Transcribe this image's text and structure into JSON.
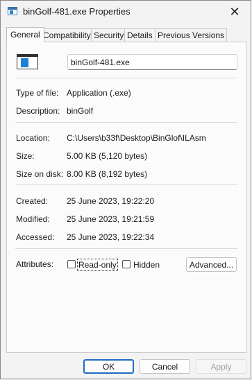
{
  "window": {
    "title": "binGolf-481.exe Properties",
    "close_glyph": "✕"
  },
  "tabs": [
    {
      "label": "General",
      "active": true
    },
    {
      "label": "Compatibility",
      "active": false
    },
    {
      "label": "Security",
      "active": false
    },
    {
      "label": "Details",
      "active": false
    },
    {
      "label": "Previous Versions",
      "active": false
    }
  ],
  "general": {
    "file_icon": "application-icon",
    "filename": "binGolf-481.exe",
    "type_label": "Type of file:",
    "type_value": "Application (.exe)",
    "description_label": "Description:",
    "description_value": "binGolf",
    "location_label": "Location:",
    "location_value": "C:\\Users\\b33f\\Desktop\\BinGlof\\ILAsm",
    "size_label": "Size:",
    "size_value": "5.00 KB (5,120 bytes)",
    "size_on_disk_label": "Size on disk:",
    "size_on_disk_value": "8.00 KB (8,192 bytes)",
    "created_label": "Created:",
    "created_value": "25 June 2023, 19:22:20",
    "modified_label": "Modified:",
    "modified_value": "25 June 2023, 19:21:59",
    "accessed_label": "Accessed:",
    "accessed_value": "25 June 2023, 19:22:34",
    "attributes_label": "Attributes:",
    "readonly_label": "Read-only",
    "readonly_checked": false,
    "hidden_label": "Hidden",
    "hidden_checked": false,
    "advanced_label": "Advanced..."
  },
  "buttons": {
    "ok": "OK",
    "cancel": "Cancel",
    "apply": "Apply"
  }
}
